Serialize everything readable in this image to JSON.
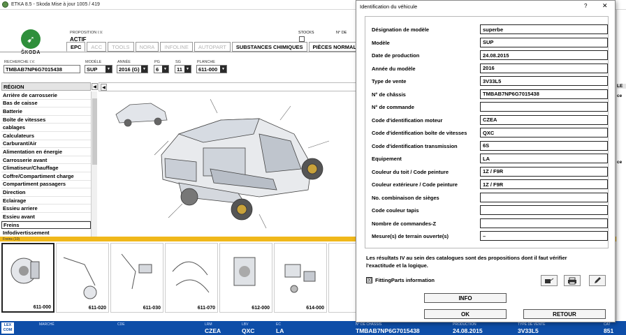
{
  "window": {
    "title": "ETKA 8.5 - Skoda Mise à jour 1005 / 419"
  },
  "brand": {
    "logo_text": "ŠKODA"
  },
  "header": {
    "proposition_label": "PROPOSITION I.V.",
    "proposition_value": "ACTIF",
    "stocks_label": "STOCKS",
    "nde_label": "N° DE"
  },
  "tabs": [
    {
      "label": "EPC",
      "state": "active"
    },
    {
      "label": "ACC",
      "state": "disabled"
    },
    {
      "label": "TOOLS",
      "state": "disabled"
    },
    {
      "label": "NORA",
      "state": "disabled"
    },
    {
      "label": "INFOLINE",
      "state": "disabled"
    },
    {
      "label": "AUTOPART",
      "state": "disabled"
    },
    {
      "label": "SUBSTANCES CHIMIQUES",
      "state": "enabled"
    },
    {
      "label": "PIÈCES NORMAL",
      "state": "enabled"
    }
  ],
  "search": {
    "vin_label": "RECHERCHE I.V.",
    "vin_value": "TMBAB7NP6G7015438",
    "model_label": "MODÈLE",
    "model_value": "SUP",
    "year_label": "ANNÉE",
    "year_value": "2016 (G)",
    "pg_label": "PG",
    "pg_value": "6",
    "sg_label": "SG",
    "sg_value": "11",
    "planche_label": "PLANCHE",
    "planche_value": "611-000"
  },
  "region": {
    "header": "RÉGION",
    "items": [
      "Arrière de carrosserie",
      "Bas de caisse",
      "Batterie",
      "Boîte de vitesses",
      "cablages",
      "Calculateurs",
      "Carburant/Air",
      "Alimentation en énergie",
      "Carrosserie avant",
      "Climatiseur/Chauffage",
      "Coffre/Compartiment charge",
      "Compartiment passagers",
      "Direction",
      "Eclairage",
      "Essieu arriere",
      "Essieu avant",
      "Freins",
      "Infodivertissement"
    ],
    "selected": "Freins"
  },
  "strip": {
    "label": "Freins (10)",
    "thumbs": [
      "611-000",
      "611-020",
      "611-030",
      "611-070",
      "612-000",
      "614-000"
    ]
  },
  "status": {
    "lexcom_top": "LEX",
    "lexcom_bottom": "COM",
    "marche_label": "MARCHÉ",
    "cde_label": "CDE",
    "lrm_label": "LRM",
    "lrm_value": "CZEA",
    "lbv_label": "LBV",
    "lbv_value": "QXC",
    "ec_label": "EC",
    "ec_value": "LA",
    "chassis_label": "N° DE CHÂSSIS",
    "chassis_value": "TMBAB7NP6G7015438",
    "prod_label": "PRODUCTION",
    "prod_value": "24.08.2015",
    "type_label": "TYPE DE VENTE",
    "type_value": "3V33L5",
    "cat_label": "CAT",
    "cat_value": "851"
  },
  "dialog": {
    "title": "Identification du véhicule",
    "help": "?",
    "close": "✕",
    "fields": [
      {
        "label": "Désignation de modèle",
        "value": "superbe"
      },
      {
        "label": "Modèle",
        "value": "SUP"
      },
      {
        "label": "Date de production",
        "value": "24.08.2015"
      },
      {
        "label": "Année du modèle",
        "value": "2016"
      },
      {
        "label": "Type de vente",
        "value": "3V33L5"
      },
      {
        "label": "N° de châssis",
        "value": "TMBAB7NP6G7015438"
      },
      {
        "label": "N° de commande",
        "value": ""
      },
      {
        "label": "Code d'identification moteur",
        "value": "CZEA"
      },
      {
        "label": "Code d'identification boîte de vitesses",
        "value": "QXC"
      },
      {
        "label": "Code d'identification transmission",
        "value": "6S"
      },
      {
        "label": "Equipement",
        "value": "LA"
      },
      {
        "label": "Couleur du toit / Code peinture",
        "value": "1Z / F9R"
      },
      {
        "label": "Couleur extérieure / Code peinture",
        "value": "1Z / F9R"
      },
      {
        "label": "No. combinaison de sièges",
        "value": ""
      },
      {
        "label": "Code couleur tapis",
        "value": ""
      },
      {
        "label": "Nombre de commandes-Z",
        "value": ""
      },
      {
        "label": "Mesure(s) de terrain ouverte(s)",
        "value": "–"
      }
    ],
    "note": "Les résultats IV au sein des catalogues sont des propositions dont il faut vérifier l'exactitude et la logique.",
    "fitting_label": "FittingParts information",
    "fitting_checked": "☒",
    "info_button": "INFO",
    "ok_button": "OK",
    "back_button": "RETOUR"
  },
  "sliver": {
    "rows": [
      "LE",
      "ce",
      "ce"
    ]
  }
}
